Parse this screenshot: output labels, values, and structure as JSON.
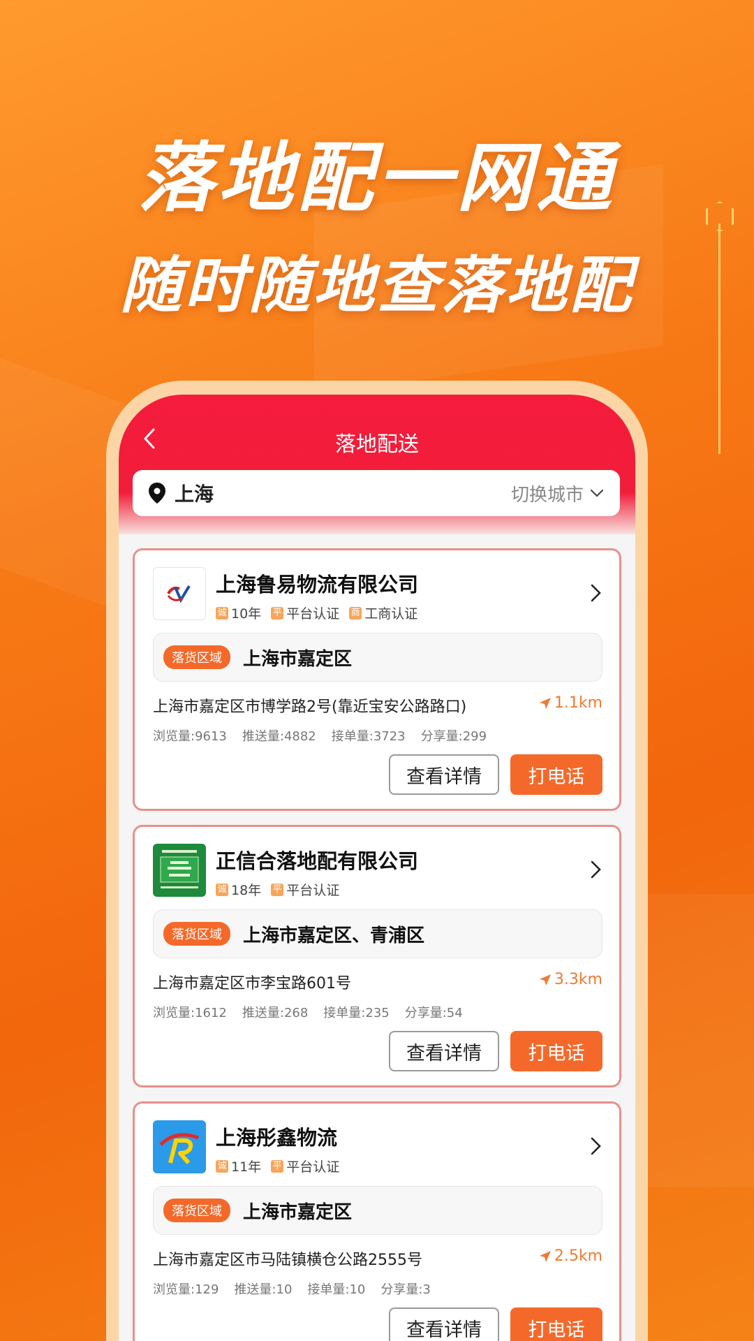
{
  "headline": {
    "line1": "落地配一网通",
    "line2": "随时随地查落地配"
  },
  "nav": {
    "title": "落地配送",
    "back_icon": "chevron-left-icon"
  },
  "city": {
    "current": "上海",
    "switch_label": "切换城市"
  },
  "colors": {
    "header_red": "#f51c3c",
    "accent_orange": "#f4692a",
    "card_border": "#e98f8a"
  },
  "cards": [
    {
      "company": "上海鲁易物流有限公司",
      "tags": [
        {
          "icon": "诚",
          "label": "10年"
        },
        {
          "icon": "平",
          "label": "平台认证"
        },
        {
          "icon": "商",
          "label": "工商认证"
        }
      ],
      "area_badge": "落货区域",
      "area": "上海市嘉定区",
      "address": "上海市嘉定区市博学路2号(靠近宝安公路路口)",
      "distance": "1.1km",
      "stats": [
        "浏览量:9613",
        "推送量:4882",
        "接单量:3723",
        "分享量:299"
      ],
      "detail_label": "查看详情",
      "call_label": "打电话"
    },
    {
      "company": "正信合落地配有限公司",
      "tags": [
        {
          "icon": "诚",
          "label": "18年"
        },
        {
          "icon": "平",
          "label": "平台认证"
        }
      ],
      "area_badge": "落货区域",
      "area": "上海市嘉定区、青浦区",
      "address": "上海市嘉定区市李宝路601号",
      "distance": "3.3km",
      "stats": [
        "浏览量:1612",
        "推送量:268",
        "接单量:235",
        "分享量:54"
      ],
      "detail_label": "查看详情",
      "call_label": "打电话"
    },
    {
      "company": "上海彤鑫物流",
      "tags": [
        {
          "icon": "诚",
          "label": "11年"
        },
        {
          "icon": "平",
          "label": "平台认证"
        }
      ],
      "area_badge": "落货区域",
      "area": "上海市嘉定区",
      "address": "上海市嘉定区市马陆镇横仓公路2555号",
      "distance": "2.5km",
      "stats": [
        "浏览量:129",
        "推送量:10",
        "接单量:10",
        "分享量:3"
      ],
      "detail_label": "查看详情",
      "call_label": "打电话"
    }
  ]
}
